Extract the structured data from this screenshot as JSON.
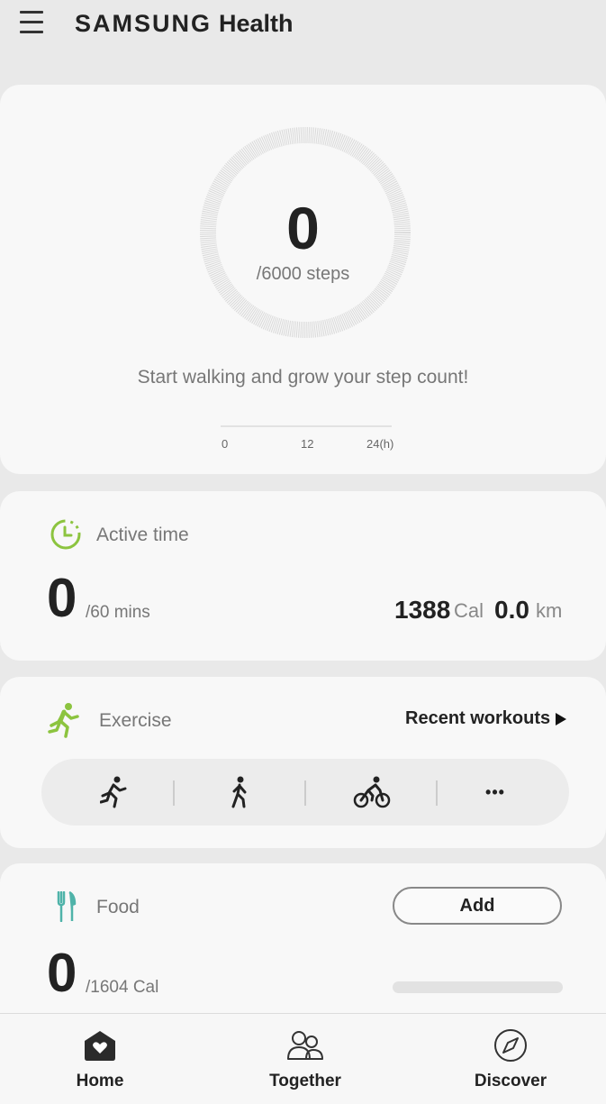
{
  "header": {
    "brand_samsung": "SAMSUNG",
    "brand_health": "Health"
  },
  "steps": {
    "value": "0",
    "goal": "/6000 steps",
    "message": "Start walking and grow your step count!",
    "ticks": [
      "0",
      "12",
      "24(h)"
    ]
  },
  "active_time": {
    "label": "Active time",
    "value": "0",
    "goal": "/60 mins",
    "calories": "1388",
    "calories_unit": "Cal",
    "distance": "0.0",
    "distance_unit": "km"
  },
  "exercise": {
    "label": "Exercise",
    "recent_workouts": "Recent workouts",
    "more": "•••"
  },
  "food": {
    "label": "Food",
    "add": "Add",
    "value": "0",
    "goal": "/1604 Cal"
  },
  "nav": {
    "home": "Home",
    "together": "Together",
    "discover": "Discover"
  },
  "colors": {
    "accent_green": "#8cc43f",
    "food_teal": "#4fb3a9",
    "ring_grey": "#dcdcdc"
  },
  "icons": {
    "menu": "hamburger-icon",
    "active_time": "timer-icon",
    "exercise": "running-person-icon",
    "food": "fork-knife-icon",
    "home": "home-heart-icon",
    "together": "people-icon",
    "discover": "compass-icon"
  }
}
